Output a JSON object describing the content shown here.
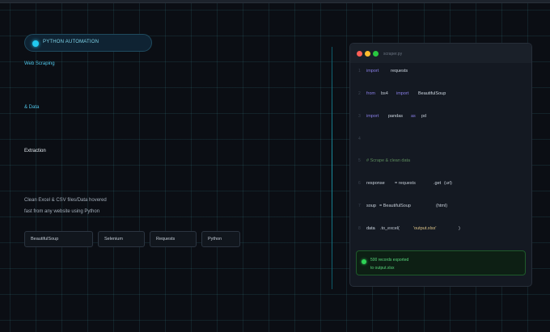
{
  "badge": {
    "label": "PYTHON AUTOMATION"
  },
  "left": {
    "line1": "Web Scraping",
    "line2": "& Data",
    "line3": "Extraction",
    "desc1": "Clean Excel & CSV files/Data hovered",
    "desc2": "fast from any website using Python"
  },
  "tags": [
    "BeautifulSoup",
    "Selenium",
    "Requests",
    "Python"
  ],
  "editor": {
    "filename": "scraper.py",
    "traffic_lights": [
      "#ff5f57",
      "#febc2e",
      "#28c840"
    ],
    "lines": [
      {
        "n": "1",
        "tokens": [
          {
            "t": "import",
            "c": "kw"
          },
          {
            "t": "requests",
            "c": "fn"
          }
        ]
      },
      {
        "n": "2",
        "tokens": [
          {
            "t": "from",
            "c": "kw"
          },
          {
            "t": "bs4",
            "c": "id"
          },
          {
            "t": "import",
            "c": "kw"
          },
          {
            "t": "BeautifulSoup",
            "c": "fn"
          }
        ]
      },
      {
        "n": "3",
        "tokens": [
          {
            "t": "import",
            "c": "kw"
          },
          {
            "t": "pandas",
            "c": "fn"
          },
          {
            "t": "as",
            "c": "kw"
          },
          {
            "t": "pd",
            "c": "id"
          }
        ]
      },
      {
        "n": "4",
        "tokens": []
      },
      {
        "n": "5",
        "tokens": [
          {
            "t": "# Scrape & clean data",
            "c": "cm"
          }
        ]
      },
      {
        "n": "6",
        "tokens": [
          {
            "t": "response",
            "c": "fn"
          },
          {
            "t": "= requests",
            "c": "id"
          },
          {
            "t": ".get",
            "c": "fn"
          },
          {
            "t": "(url)",
            "c": "id"
          }
        ]
      },
      {
        "n": "7",
        "tokens": [
          {
            "t": "soup",
            "c": "fn"
          },
          {
            "t": "= BeautifulSoup",
            "c": "id"
          },
          {
            "t": "(html)",
            "c": "id"
          }
        ]
      },
      {
        "n": "8",
        "tokens": [
          {
            "t": "data",
            "c": "fn"
          },
          {
            "t": ".to_excel(",
            "c": "id"
          },
          {
            "t": "'output.xlsx'",
            "c": "str"
          },
          {
            "t": ")",
            "c": "id"
          }
        ]
      }
    ]
  },
  "status": {
    "line1": "500 records exported",
    "line2": "to output.xlsx"
  },
  "colors": {
    "accent": "#22c9ef",
    "success": "#2ed356",
    "background": "#0b0e14"
  }
}
